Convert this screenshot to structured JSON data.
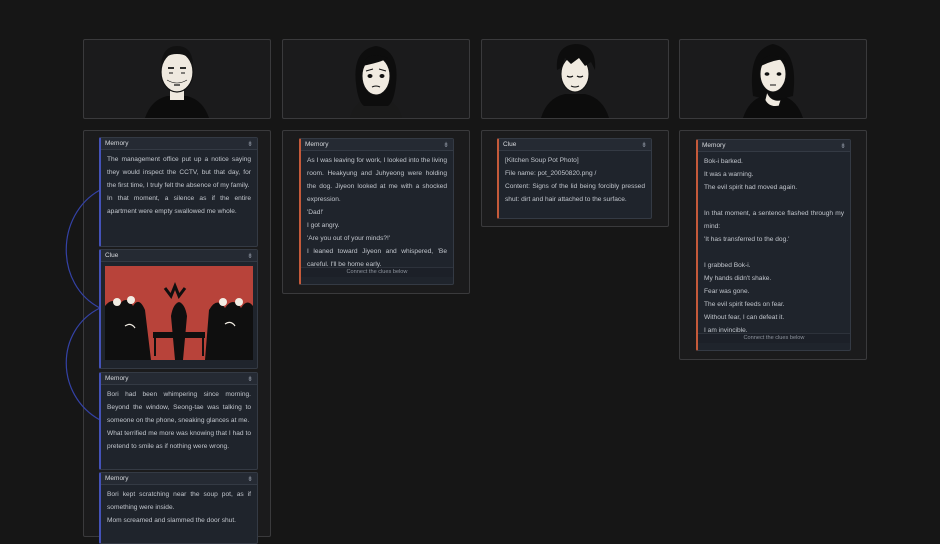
{
  "portraits": [
    {
      "name": "older-man-portrait-icon"
    },
    {
      "name": "worried-woman-portrait-icon"
    },
    {
      "name": "young-man-portrait-icon"
    },
    {
      "name": "young-woman-portrait-icon"
    }
  ],
  "col1": {
    "card1": {
      "type": "Memory",
      "lines": [
        "The management office put up a notice saying they would inspect the CCTV, but that day, for the first time, I truly felt the absence of my family.",
        "In that moment, a silence as if the entire apartment were empty swallowed me whole."
      ]
    },
    "card2": {
      "type": "Clue"
    },
    "card3": {
      "type": "Memory",
      "lines": [
        "Bori had been whimpering since morning. Beyond the window, Seong-tae was talking to someone on the phone, sneaking glances at me.",
        "What terrified me more was knowing that I had to pretend to smile as if nothing were wrong."
      ]
    },
    "card4": {
      "type": "Memory",
      "lines": [
        "Bori kept scratching near the soup pot, as if something were inside.",
        "Mom screamed and slammed the door shut."
      ]
    }
  },
  "col2": {
    "card": {
      "type": "Memory",
      "lines": [
        "As I was leaving for work, I looked into the living room. Heakyung and Juhyeong were holding the dog. Jiyeon looked at me with a shocked expression.",
        "'Dad!'",
        "I got angry.",
        "'Are you out of your minds?!'",
        "I leaned toward Jiyeon and whispered, 'Be careful. I'll be home early."
      ],
      "footer": "Connect the clues below"
    }
  },
  "col3": {
    "card": {
      "type": "Clue",
      "lines": [
        "[Kitchen Soup Pot Photo]",
        "File name: pot_20050820.png /",
        "Content: Signs of the lid being forcibly pressed shut: dirt and hair attached to the surface."
      ]
    }
  },
  "col4": {
    "card": {
      "type": "Memory",
      "lines": [
        "Bok-i barked.",
        "It was a warning.",
        "The evil spirit had moved again.",
        "",
        "In that moment, a sentence flashed through my mind:",
        "'It has transferred to the dog.'",
        "",
        "I grabbed Bok-i.",
        "My hands didn't shake.",
        "Fear was gone.",
        "The evil spirit feeds on fear.",
        "Without fear, I can defeat it.",
        "I am invincible."
      ],
      "footer": "Connect the clues below"
    }
  },
  "colors": {
    "background": "#161616",
    "panel": "#1b1b1c",
    "card": "#1f242c",
    "memory_accent": "#4452b8",
    "clue_accent": "#c55a3a",
    "clue_image_red": "#b8433a"
  }
}
